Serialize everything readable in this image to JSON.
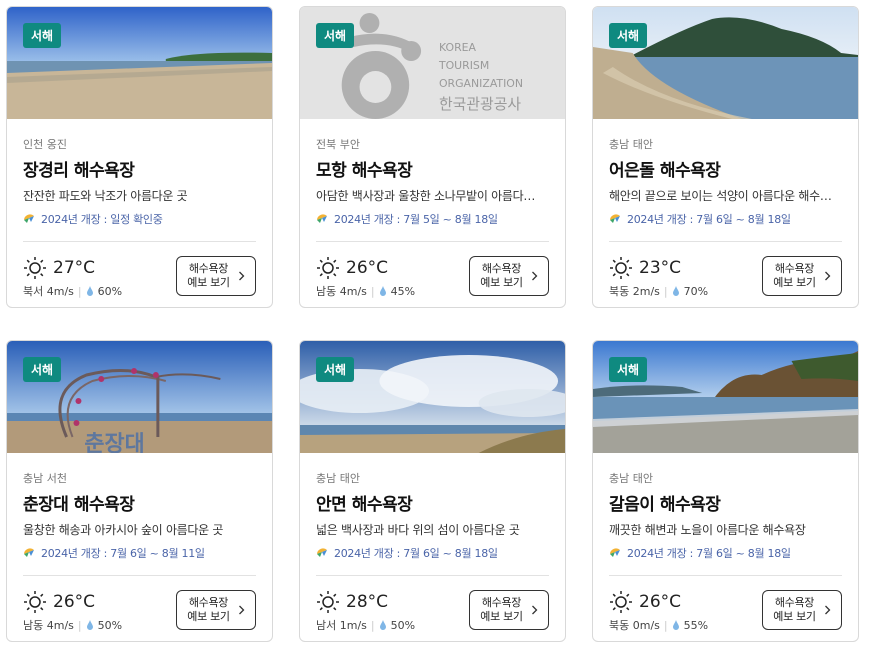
{
  "cards": [
    {
      "badge": "서해",
      "region": "인천 옹진",
      "name": "장경리 해수욕장",
      "desc": "잔잔한 파도와 낙조가 아름다운 곳",
      "open": "2024년 개장 : 일정 확인중",
      "temp": "27°C",
      "wind": "북서 4m/s",
      "humidity": "60%",
      "button_line1": "해수욕장",
      "button_line2": "예보 보기"
    },
    {
      "badge": "서해",
      "region": "전북 부안",
      "name": "모항 해수욕장",
      "desc": "아담한 백사장과 울창한 소나무밭이 아름다…",
      "open": "2024년 개장 : 7월 5일 ~ 8월 18일",
      "temp": "26°C",
      "wind": "남동 4m/s",
      "humidity": "45%",
      "button_line1": "해수욕장",
      "button_line2": "예보 보기",
      "logo": {
        "line1": "KOREA",
        "line2": "TOURISM",
        "line3": "ORGANIZATION",
        "line4": "한국관광공사"
      }
    },
    {
      "badge": "서해",
      "region": "충남 태안",
      "name": "어은돌 해수욕장",
      "desc": "해안의 끝으로 보이는 석양이 아름다운 해수…",
      "open": "2024년 개장 : 7월 6일 ~ 8월 18일",
      "temp": "23°C",
      "wind": "북동 2m/s",
      "humidity": "70%",
      "button_line1": "해수욕장",
      "button_line2": "예보 보기"
    },
    {
      "badge": "서해",
      "region": "충남 서천",
      "name": "춘장대 해수욕장",
      "desc": "울창한 해송과 아카시아 숲이 아름다운 곳",
      "open": "2024년 개장 : 7월 6일 ~ 8월 11일",
      "temp": "26°C",
      "wind": "남동 4m/s",
      "humidity": "50%",
      "button_line1": "해수욕장",
      "button_line2": "예보 보기"
    },
    {
      "badge": "서해",
      "region": "충남 태안",
      "name": "안면 해수욕장",
      "desc": "넓은 백사장과 바다 위의 섬이 아름다운 곳",
      "open": "2024년 개장 : 7월 6일 ~ 8월 18일",
      "temp": "28°C",
      "wind": "남서 1m/s",
      "humidity": "50%",
      "button_line1": "해수욕장",
      "button_line2": "예보 보기"
    },
    {
      "badge": "서해",
      "region": "충남 태안",
      "name": "갈음이 해수욕장",
      "desc": "깨끗한 해변과 노을이 아름다운 해수욕장",
      "open": "2024년 개장 : 7월 6일 ~ 8월 18일",
      "temp": "26°C",
      "wind": "북동 0m/s",
      "humidity": "55%",
      "button_line1": "해수욕장",
      "button_line2": "예보 보기"
    }
  ],
  "colors": {
    "badge": "#0f8a80",
    "open_text": "#4a64a8",
    "drop": "#7fb6e6",
    "card_border": "#d9d9d9"
  }
}
